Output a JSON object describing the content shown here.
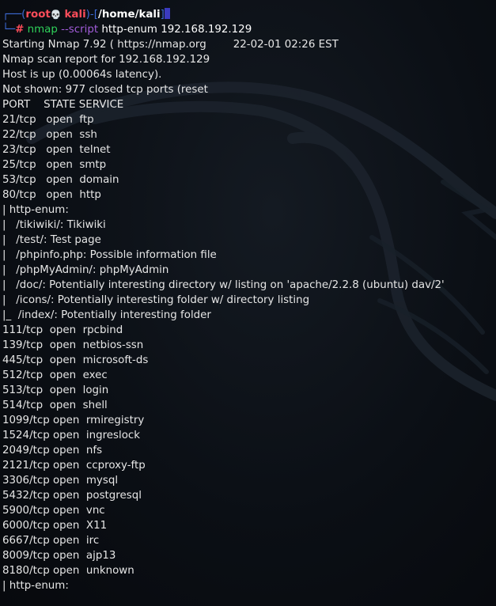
{
  "prompt": {
    "corner_top": "┌──(",
    "user": "root",
    "skull": "💀",
    "host": "kali",
    "sep": ")-[",
    "cwd": "/home/kali",
    "close": "]",
    "corner_bottom": "└─",
    "hash": "#",
    "command": "nmap",
    "flag": "--script",
    "args": "http-enum 192.168.192.129"
  },
  "output": {
    "starting_left": "Starting Nmap 7.92 ( https://nmap.org",
    "starting_right": "22-02-01 02:26 EST",
    "lines": [
      "Nmap scan report for 192.168.192.129",
      "Host is up (0.00064s latency).",
      "Not shown: 977 closed tcp ports (reset",
      "PORT    STATE SERVICE",
      "21/tcp   open  ftp",
      "22/tcp   open  ssh",
      "23/tcp   open  telnet",
      "25/tcp   open  smtp",
      "53/tcp   open  domain",
      "80/tcp   open  http",
      "| http-enum:",
      "|   /tikiwiki/: Tikiwiki",
      "|   /test/: Test page",
      "|   /phpinfo.php: Possible information file",
      "|   /phpMyAdmin/: phpMyAdmin",
      "|   /doc/: Potentially interesting directory w/ listing on 'apache/2.2.8 (ubuntu) dav/2'",
      "|   /icons/: Potentially interesting folder w/ directory listing",
      "|_  /index/: Potentially interesting folder",
      "111/tcp  open  rpcbind",
      "139/tcp  open  netbios-ssn",
      "445/tcp  open  microsoft-ds",
      "512/tcp  open  exec",
      "513/tcp  open  login",
      "514/tcp  open  shell",
      "1099/tcp open  rmiregistry",
      "1524/tcp open  ingreslock",
      "2049/tcp open  nfs",
      "2121/tcp open  ccproxy-ftp",
      "3306/tcp open  mysql",
      "5432/tcp open  postgresql",
      "5900/tcp open  vnc",
      "6000/tcp open  X11",
      "6667/tcp open  irc",
      "8009/tcp open  ajp13",
      "8180/tcp open  unknown",
      "| http-enum:"
    ]
  }
}
